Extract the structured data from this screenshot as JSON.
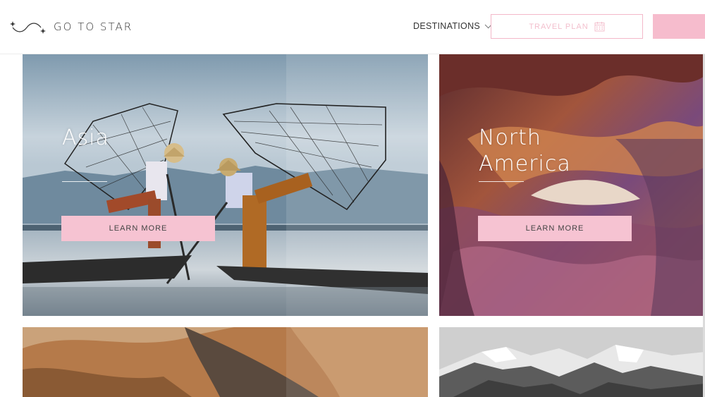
{
  "header": {
    "logo_text": "GO TO STAR",
    "nav": {
      "destinations_label": "DESTINATIONS"
    },
    "travel_plan_label": "TRAVEL PLAN"
  },
  "cards": [
    {
      "title": "Asia",
      "button_label": "LEARN MORE"
    },
    {
      "title": "North\nAmerica",
      "button_label": "LEARN MORE"
    }
  ],
  "colors": {
    "accent_pink": "#f6bccd",
    "outline_pink": "#f3b8c9",
    "text_dark": "#333333"
  },
  "icons": [
    "star-swirl-logo-icon",
    "chevron-down-icon",
    "calendar-icon"
  ]
}
